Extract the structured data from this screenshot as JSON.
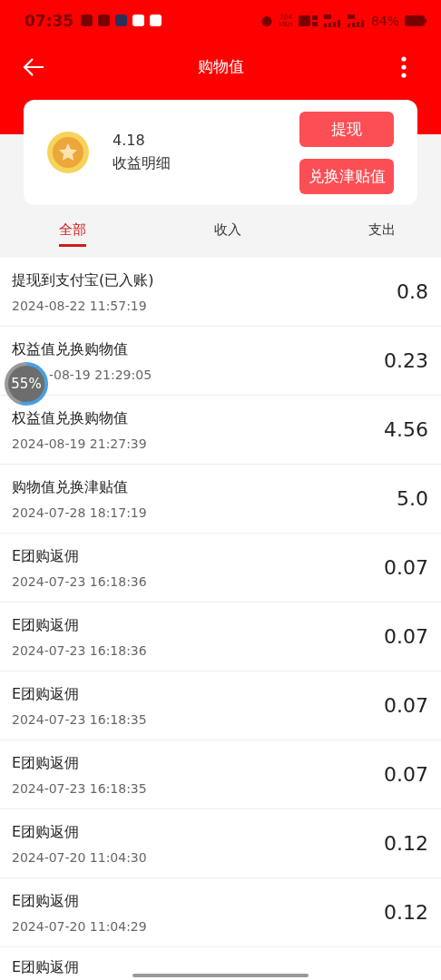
{
  "status_bar": {
    "time": "07:35",
    "speed": "204",
    "speed_unit": "KB/s",
    "battery": "84%"
  },
  "header": {
    "title": "购物值"
  },
  "summary": {
    "amount": "4.18",
    "label": "收益明细",
    "buttons": [
      "提现",
      "兑换津贴值"
    ]
  },
  "tabs": [
    {
      "label": "全部",
      "selected": true
    },
    {
      "label": "收入",
      "selected": false
    },
    {
      "label": "支出",
      "selected": false
    }
  ],
  "records": [
    {
      "title": "提现到支付宝(已入账)",
      "time": "2024-08-22 11:57:19",
      "amount": "0.8"
    },
    {
      "title": "权益值兑换购物值",
      "time": "-08-19 21:29:05",
      "amount": "0.23",
      "kind": "covered"
    },
    {
      "title": "权益值兑换购物值",
      "time": "2024-08-19 21:27:39",
      "amount": "4.56"
    },
    {
      "title": "购物值兑换津贴值",
      "time": "2024-07-28 18:17:19",
      "amount": "5.0"
    },
    {
      "title": "E团购返佣",
      "time": "2024-07-23 16:18:36",
      "amount": "0.07"
    },
    {
      "title": "E团购返佣",
      "time": "2024-07-23 16:18:36",
      "amount": "0.07"
    },
    {
      "title": "E团购返佣",
      "time": "2024-07-23 16:18:35",
      "amount": "0.07"
    },
    {
      "title": "E团购返佣",
      "time": "2024-07-23 16:18:35",
      "amount": "0.07"
    },
    {
      "title": "E团购返佣",
      "time": "2024-07-20 11:04:30",
      "amount": "0.12"
    },
    {
      "title": "E团购返佣",
      "time": "2024-07-20 11:04:29",
      "amount": "0.12"
    },
    {
      "title": "E团购返佣"
    }
  ],
  "floating_ball": {
    "label": "55%"
  }
}
